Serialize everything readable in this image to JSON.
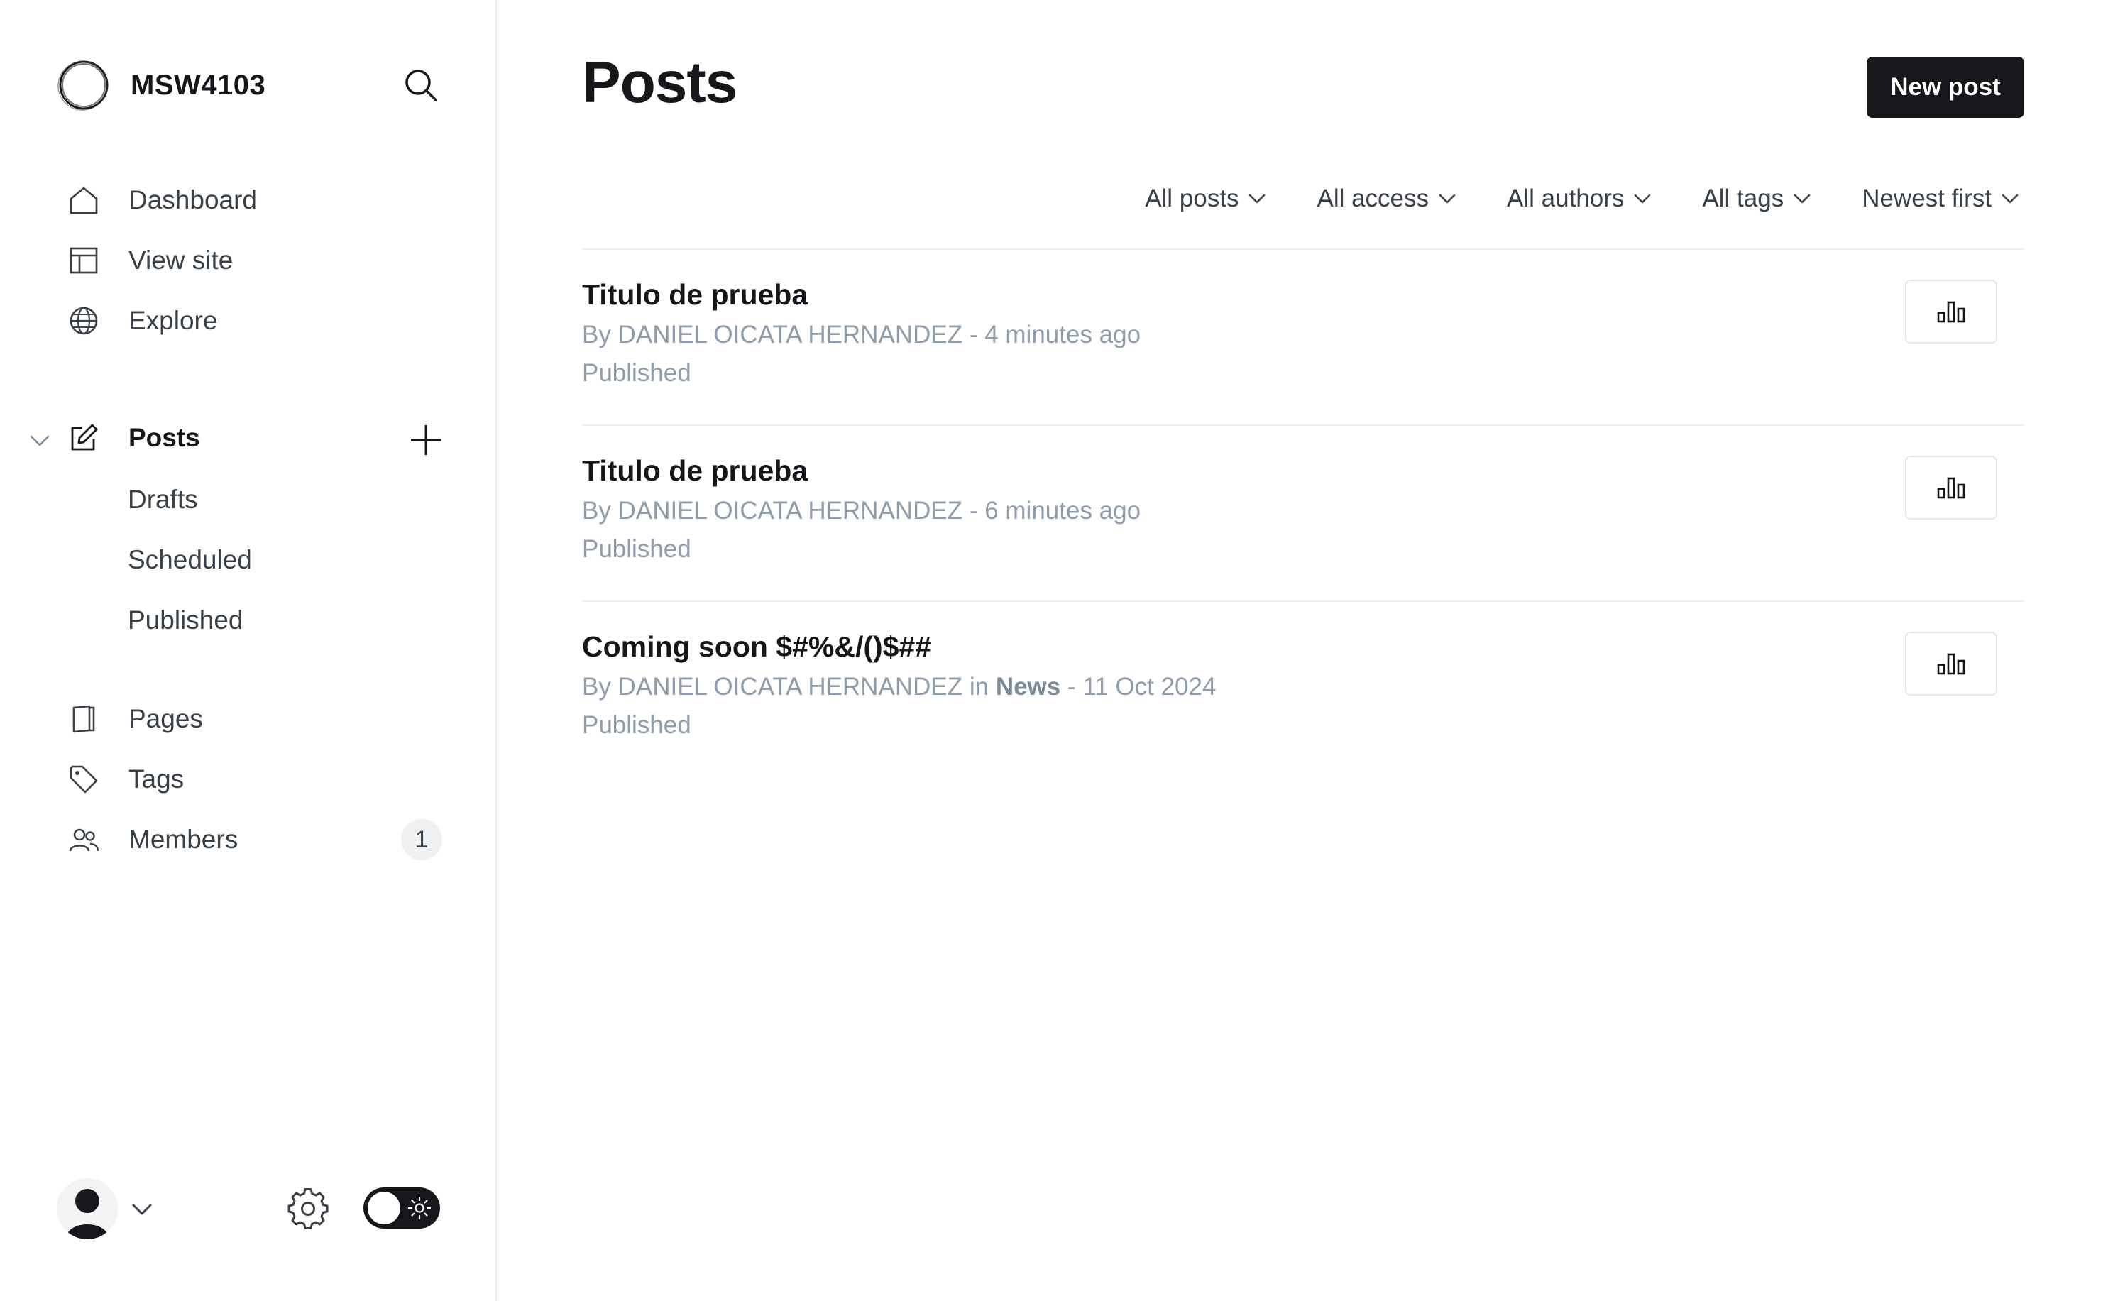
{
  "brand": {
    "name": "MSW4103"
  },
  "sidebar": {
    "primary": [
      {
        "label": "Dashboard",
        "icon": "home-icon"
      },
      {
        "label": "View site",
        "icon": "layout-icon"
      },
      {
        "label": "Explore",
        "icon": "globe-icon"
      }
    ],
    "posts": {
      "label": "Posts",
      "sub": [
        "Drafts",
        "Scheduled",
        "Published"
      ]
    },
    "secondary": [
      {
        "label": "Pages",
        "icon": "pages-icon"
      },
      {
        "label": "Tags",
        "icon": "tag-icon"
      },
      {
        "label": "Members",
        "icon": "members-icon",
        "badge": "1"
      }
    ]
  },
  "header": {
    "title": "Posts",
    "new_post_label": "New post"
  },
  "filters": [
    "All posts",
    "All access",
    "All authors",
    "All tags",
    "Newest first"
  ],
  "posts": [
    {
      "title": "Titulo de prueba",
      "by": "By DANIEL OICATA HERNANDEZ",
      "in_label": "",
      "tag": "",
      "time": " - 4 minutes ago",
      "status": "Published"
    },
    {
      "title": "Titulo de prueba",
      "by": "By DANIEL OICATA HERNANDEZ",
      "in_label": "",
      "tag": "",
      "time": " - 6 minutes ago",
      "status": "Published"
    },
    {
      "title": "Coming soon $#%&/()$##",
      "by": "By DANIEL OICATA HERNANDEZ",
      "in_label": " in ",
      "tag": "News",
      "time": " - 11 Oct 2024",
      "status": "Published"
    }
  ],
  "colors": {
    "accent": "#15171a",
    "muted": "#8e9cac",
    "border": "#ebeef0"
  }
}
